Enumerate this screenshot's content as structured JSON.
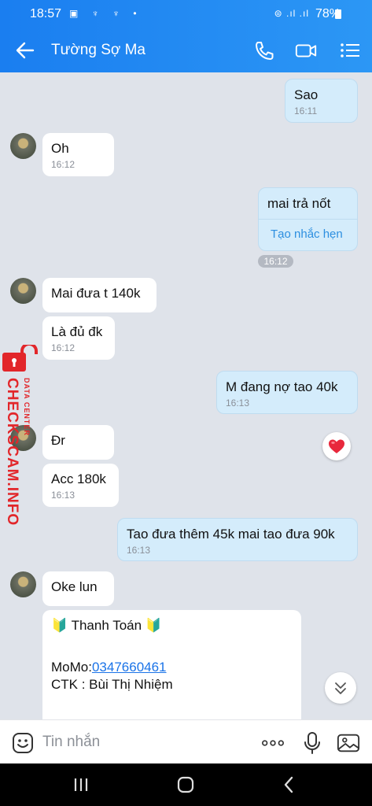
{
  "status": {
    "time": "18:57",
    "left_icons": "▣ ♆ ♆ •",
    "signal": "⊜ .ıl .ıl",
    "battery": "78%"
  },
  "header": {
    "title": "Tường Sợ Ma",
    "icons": [
      "back-arrow-icon",
      "phone-icon",
      "video-call-icon",
      "menu-list-icon"
    ]
  },
  "messages": [
    {
      "side": "out",
      "text": "Sao",
      "time": "16:11"
    },
    {
      "side": "in",
      "text": "Oh",
      "time": "16:12"
    },
    {
      "side": "out",
      "text": "mai trả nốt",
      "reminder": "Tạo nhắc hẹn"
    },
    {
      "side": "divider",
      "time": "16:12"
    },
    {
      "side": "in",
      "text": "Mai đưa t 140k"
    },
    {
      "side": "in",
      "text": "Là đủ đk",
      "time": "16:12"
    },
    {
      "side": "out",
      "text": "M đang nợ tao 40k",
      "time": "16:13"
    },
    {
      "side": "in",
      "text": "Đr"
    },
    {
      "side": "in",
      "text": "Acc 180k",
      "time": "16:13"
    },
    {
      "side": "out",
      "text": "Tao đưa thêm 45k mai tao đưa 90k",
      "time": "16:13"
    },
    {
      "side": "in",
      "text": "Oke lun"
    },
    {
      "side": "in",
      "title": "🔰 Thanh Toán 🔰",
      "momo_label": "MoMo:",
      "momo_number": "0347660461",
      "ctk": "CTK : Bùi Thị Nhiệm"
    }
  ],
  "watermark": {
    "main": "CHECKSCAM.INFO",
    "sub": "DATA CENTER"
  },
  "input": {
    "placeholder": "Tin nhắn"
  },
  "colors": {
    "accent": "#1a7ef0",
    "out_bubble": "#d4ecfb",
    "in_bubble": "#ffffff",
    "chat_bg": "#dfe3ea",
    "watermark": "#e2262a",
    "heart": "#e8283c"
  }
}
